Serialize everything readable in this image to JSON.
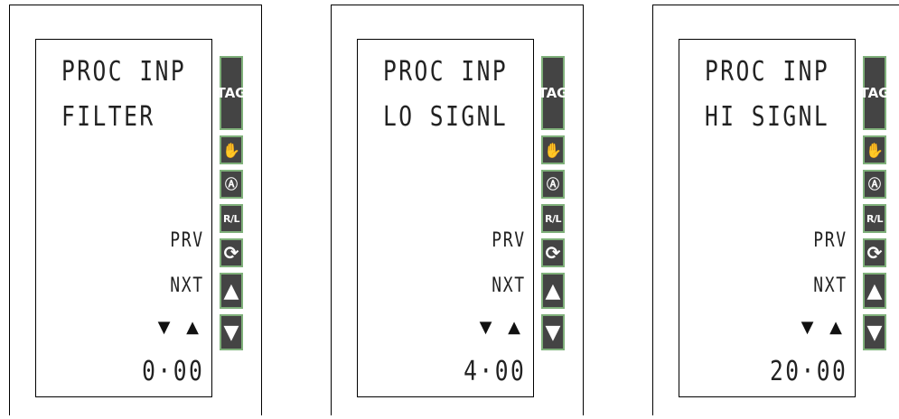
{
  "panels": [
    {
      "line1": "PROC INP",
      "line2": "FILTER",
      "prv": "PRV",
      "nxt": "NXT",
      "arrows": "▼ ▲",
      "value": "0·00"
    },
    {
      "line1": "PROC INP",
      "line2": "LO SIGNL",
      "prv": "PRV",
      "nxt": "NXT",
      "arrows": "▼ ▲",
      "value": "4·00"
    },
    {
      "line1": "PROC INP",
      "line2": "HI SIGNL",
      "prv": "PRV",
      "nxt": "NXT",
      "arrows": "▼ ▲",
      "value": "20·00"
    }
  ],
  "keys": {
    "tag": "TAG",
    "manual_icon": "✋",
    "auto_icon": "Ⓐ",
    "rl": "R/L",
    "refresh_icon": "⟳",
    "up_icon": "▲",
    "down_icon": "▼",
    "icon_names": [
      "hand-icon",
      "auto-icon",
      "refresh-icon",
      "up-arrow-icon",
      "down-arrow-icon"
    ]
  }
}
